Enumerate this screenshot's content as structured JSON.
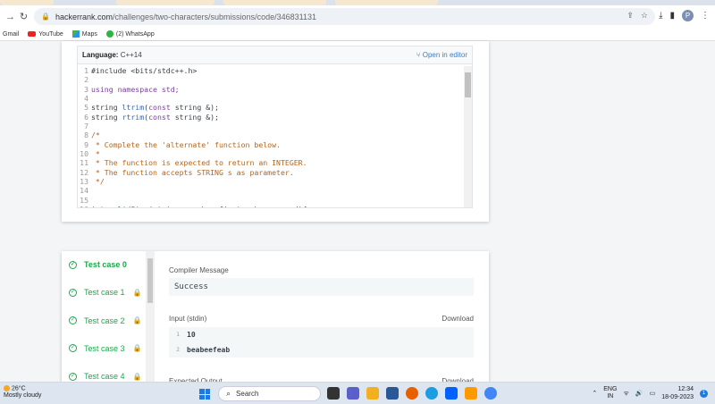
{
  "browser": {
    "url_host": "hackerrank.com",
    "url_path": "/challenges/two-characters/submissions/code/346831131",
    "bookmarks": [
      "Gmail",
      "YouTube",
      "Maps",
      "(2) WhatsApp"
    ],
    "profile_initial": "P"
  },
  "editor": {
    "language_label": "Language:",
    "language_value": "C++14",
    "open_in_editor": "Open in editor",
    "lines": [
      {
        "n": "1",
        "parts": [
          {
            "t": "#include <bits/stdc++.h>",
            "c": ""
          }
        ]
      },
      {
        "n": "2",
        "parts": []
      },
      {
        "n": "3",
        "parts": [
          {
            "t": "using namespace std;",
            "c": "kw"
          }
        ]
      },
      {
        "n": "4",
        "parts": []
      },
      {
        "n": "5",
        "parts": [
          {
            "t": "string ",
            "c": ""
          },
          {
            "t": "ltrim",
            "c": "fn"
          },
          {
            "t": "(",
            "c": ""
          },
          {
            "t": "const",
            "c": "kw"
          },
          {
            "t": " string &);",
            "c": ""
          }
        ]
      },
      {
        "n": "6",
        "parts": [
          {
            "t": "string ",
            "c": ""
          },
          {
            "t": "rtrim",
            "c": "fn"
          },
          {
            "t": "(",
            "c": ""
          },
          {
            "t": "const",
            "c": "kw"
          },
          {
            "t": " string &);",
            "c": ""
          }
        ]
      },
      {
        "n": "7",
        "parts": []
      },
      {
        "n": "8",
        "parts": [
          {
            "t": "/*",
            "c": "cm"
          }
        ]
      },
      {
        "n": "9",
        "parts": [
          {
            "t": " * Complete the 'alternate' function below.",
            "c": "cm"
          }
        ]
      },
      {
        "n": "10",
        "parts": [
          {
            "t": " *",
            "c": "cm"
          }
        ]
      },
      {
        "n": "11",
        "parts": [
          {
            "t": " * The function is expected to return an INTEGER.",
            "c": "cm"
          }
        ]
      },
      {
        "n": "12",
        "parts": [
          {
            "t": " * The function accepts STRING s as parameter.",
            "c": "cm"
          }
        ]
      },
      {
        "n": "13",
        "parts": [
          {
            "t": " */",
            "c": "cm"
          }
        ]
      },
      {
        "n": "14",
        "parts": []
      },
      {
        "n": "15",
        "parts": []
      },
      {
        "n": "16",
        "parts": [
          {
            "t": "int ",
            "c": "kw"
          },
          {
            "t": "validSize",
            "c": "fn"
          },
          {
            "t": "(string s, ",
            "c": ""
          },
          {
            "t": "char",
            "c": "kw"
          },
          {
            "t": " first, ",
            "c": ""
          },
          {
            "t": "char",
            "c": "kw"
          },
          {
            "t": " second){",
            "c": ""
          }
        ]
      }
    ]
  },
  "testcases": [
    {
      "label": "Test case 0",
      "locked": false,
      "active": true
    },
    {
      "label": "Test case 1",
      "locked": true,
      "active": false
    },
    {
      "label": "Test case 2",
      "locked": true,
      "active": false
    },
    {
      "label": "Test case 3",
      "locked": true,
      "active": false
    },
    {
      "label": "Test case 4",
      "locked": true,
      "active": false
    }
  ],
  "result": {
    "compiler_label": "Compiler Message",
    "compiler_message": "Success",
    "input_label": "Input (stdin)",
    "download": "Download",
    "input_lines": [
      {
        "n": "1",
        "text": "10"
      },
      {
        "n": "2",
        "text": "beabeefeab"
      }
    ],
    "expected_label": "Expected Output"
  },
  "taskbar": {
    "temp": "26°C",
    "weather": "Mostly cloudy",
    "search": "Search",
    "lang1": "ENG",
    "lang2": "IN",
    "time": "12:34",
    "date": "18-09-2023",
    "notifications": "1"
  },
  "colors": {
    "accent": "#1ba94c",
    "link": "#3f7fbf"
  }
}
